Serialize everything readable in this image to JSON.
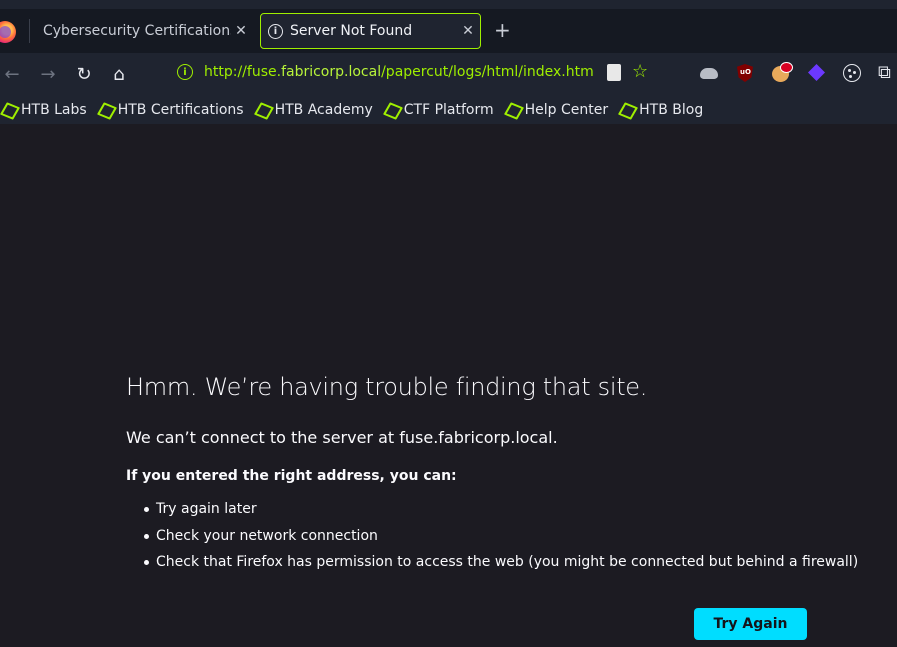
{
  "tabs": [
    {
      "title": "Cybersecurity Certifications |",
      "close": "✕"
    },
    {
      "title": "Server Not Found",
      "close": "✕"
    }
  ],
  "new_tab": "+",
  "nav": {
    "back": "←",
    "forward": "→",
    "reload": "↻",
    "home": "⌂",
    "url_prefix": "http://fuse.",
    "url_host": "fabricorp.local",
    "url_path": "/papercut/logs/html/index.htm",
    "bookmark_star": "☆",
    "extensions_icon": "⧉",
    "ublock_text": "uO"
  },
  "bookmarks": [
    {
      "label": "HTB Labs"
    },
    {
      "label": "HTB Certifications"
    },
    {
      "label": "HTB Academy"
    },
    {
      "label": "CTF Platform"
    },
    {
      "label": "Help Center"
    },
    {
      "label": "HTB Blog"
    }
  ],
  "error": {
    "title": "Hmm. We’re having trouble finding that site.",
    "description": "We can’t connect to the server at fuse.fabricorp.local.",
    "subheading": "If you entered the right address, you can:",
    "suggestions": [
      "Try again later",
      "Check your network connection",
      "Check that Firefox has permission to access the web (you might be connected but behind a firewall)"
    ],
    "button": "Try Again"
  },
  "colors": {
    "accent": "#9fef00",
    "button": "#00ddff",
    "background": "#1c1b22"
  }
}
